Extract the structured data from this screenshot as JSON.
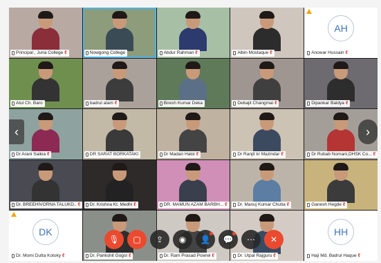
{
  "participants": [
    {
      "name": "Principal , Juria College",
      "muted": true,
      "avatar": "",
      "active": false,
      "warn": false,
      "dev": "phone",
      "bg": "#b8a9a3",
      "shirt": "#8a2e3a"
    },
    {
      "name": "Nowgong College",
      "muted": false,
      "avatar": "",
      "active": true,
      "warn": false,
      "dev": "mic",
      "bg": "#8d9c7a",
      "shirt": "#3b4b55"
    },
    {
      "name": "Abdur Rahman",
      "muted": true,
      "avatar": "",
      "active": false,
      "warn": false,
      "dev": "phone",
      "bg": "#a7bfa5",
      "shirt": "#2c3a6e"
    },
    {
      "name": "Albin Mostaque",
      "muted": true,
      "avatar": "",
      "active": false,
      "warn": false,
      "dev": "phone",
      "bg": "#cfc6bd",
      "shirt": "#2c2c2c"
    },
    {
      "name": "Anowar Hussain",
      "muted": true,
      "avatar": "AH",
      "active": false,
      "warn": true,
      "dev": "phone",
      "bg": "#ffffff",
      "shirt": ""
    },
    {
      "name": "Atul Ch. Baro",
      "muted": false,
      "avatar": "",
      "active": false,
      "warn": false,
      "dev": "phone",
      "bg": "#6f8f4f",
      "shirt": "#333333"
    },
    {
      "name": "badrul alam",
      "muted": true,
      "avatar": "",
      "active": false,
      "warn": false,
      "dev": "phone",
      "bg": "#a9a19a",
      "shirt": "#3c3c3c"
    },
    {
      "name": "Biresh Kumar Deka",
      "muted": false,
      "avatar": "",
      "active": false,
      "warn": false,
      "dev": "phone",
      "bg": "#5f7a59",
      "shirt": "#5b6f86"
    },
    {
      "name": "Debajit Changmai",
      "muted": true,
      "avatar": "",
      "active": false,
      "warn": false,
      "dev": "phone",
      "bg": "#9f9591",
      "shirt": "#3f3f3f"
    },
    {
      "name": "Dipankar Baidya",
      "muted": true,
      "avatar": "",
      "active": false,
      "warn": false,
      "dev": "phone",
      "bg": "#6d6a70",
      "shirt": "#2d2d2d"
    },
    {
      "name": "Dr Arani Saikia",
      "muted": true,
      "avatar": "",
      "active": false,
      "warn": false,
      "dev": "phone",
      "bg": "#8ea3a0",
      "shirt": "#8d2a54"
    },
    {
      "name": "DR SARAT BORKATAKI",
      "muted": false,
      "avatar": "",
      "active": false,
      "warn": false,
      "dev": "mic",
      "bg": "#c2b9a6",
      "shirt": "#3a3a3a"
    },
    {
      "name": "Dr Madan Haloi",
      "muted": true,
      "avatar": "",
      "active": false,
      "warn": false,
      "dev": "phone",
      "bg": "#c0b2a0",
      "shirt": "#444444"
    },
    {
      "name": "Dr Ranjit kr Mazindar",
      "muted": true,
      "avatar": "",
      "active": false,
      "warn": false,
      "dev": "phone",
      "bg": "#cdc3b4",
      "shirt": "#3b4a5e"
    },
    {
      "name": "Dr Rubab Nomani,DHSK Co...",
      "muted": true,
      "avatar": "",
      "active": false,
      "warn": false,
      "dev": "phone",
      "bg": "#a49e99",
      "shirt": "#b53434"
    },
    {
      "name": "Dr. BREEHIVORNA TALUKD...",
      "muted": true,
      "avatar": "",
      "active": false,
      "warn": false,
      "dev": "phone",
      "bg": "#4a4a52",
      "shirt": "#333333"
    },
    {
      "name": "Dr. Krishna Kt. Medhi",
      "muted": true,
      "avatar": "",
      "active": false,
      "warn": false,
      "dev": "mic",
      "bg": "#2f2a2a",
      "shirt": "#222222"
    },
    {
      "name": "DR. MAMUN AZAM BARBH...",
      "muted": true,
      "avatar": "",
      "active": false,
      "warn": false,
      "dev": "mic",
      "bg": "#cf8fb6",
      "shirt": "#3a3f4d"
    },
    {
      "name": "Dr. Manuj Kumar Chutia",
      "muted": true,
      "avatar": "",
      "active": false,
      "warn": false,
      "dev": "phone",
      "bg": "#bdb4a9",
      "shirt": "#5b7ea2"
    },
    {
      "name": "Ganesh Hegde",
      "muted": true,
      "avatar": "",
      "active": false,
      "warn": false,
      "dev": "phone",
      "bg": "#c9b37c",
      "shirt": "#3b3b3b"
    },
    {
      "name": "Dr. Momi Dutta Kotoky",
      "muted": true,
      "avatar": "DK",
      "active": false,
      "warn": true,
      "dev": "mic",
      "bg": "#ffffff",
      "shirt": ""
    },
    {
      "name": "Dr. Parikshit Gogoi",
      "muted": true,
      "avatar": "",
      "active": false,
      "warn": false,
      "dev": "mic",
      "bg": "#8b8f8a",
      "shirt": "#2e2e2e"
    },
    {
      "name": "Dr. Ram Prasad Powrel",
      "muted": true,
      "avatar": "",
      "active": false,
      "warn": false,
      "dev": "mic",
      "bg": "#cfc9c4",
      "shirt": "#444444"
    },
    {
      "name": "Dr. Utpal Rajguru",
      "muted": true,
      "avatar": "",
      "active": false,
      "warn": false,
      "dev": "mic",
      "bg": "#d3cbc4",
      "shirt": "#394b63"
    },
    {
      "name": "Haji Md. Badrul Haque",
      "muted": true,
      "avatar": "HH",
      "active": false,
      "warn": false,
      "dev": "phone",
      "bg": "#ffffff",
      "shirt": ""
    }
  ],
  "nav": {
    "prev": "‹",
    "next": "›"
  },
  "toolbar": [
    {
      "id": "mute-mic-button",
      "icon": "mic-off-icon",
      "glyph": "🎙",
      "red": true,
      "dot": false
    },
    {
      "id": "stop-video-button",
      "icon": "video-off-icon",
      "glyph": "▢",
      "red": true,
      "dot": false
    },
    {
      "id": "share-screen-button",
      "icon": "share-icon",
      "glyph": "⇪",
      "red": false,
      "dot": false
    },
    {
      "id": "record-button",
      "icon": "record-icon",
      "glyph": "◉",
      "red": false,
      "dot": false
    },
    {
      "id": "participants-button",
      "icon": "participants-icon",
      "glyph": "👤",
      "red": false,
      "dot": true
    },
    {
      "id": "chat-button",
      "icon": "chat-icon",
      "glyph": "💬",
      "red": false,
      "dot": true
    },
    {
      "id": "more-button",
      "icon": "more-icon",
      "glyph": "⋯",
      "red": false,
      "dot": false
    },
    {
      "id": "leave-button",
      "icon": "close-icon",
      "glyph": "✕",
      "red": true,
      "dot": false
    }
  ],
  "muted_glyph": "ℓ",
  "colors": {
    "active_border": "#4fb3e8",
    "avatar_text": "#3d74b8",
    "leave_red": "#ea4a2f",
    "warn": "#f2a500"
  }
}
